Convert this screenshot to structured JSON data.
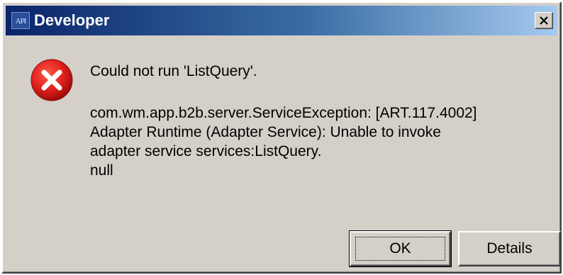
{
  "window": {
    "app_icon_text": "API",
    "title": "Developer"
  },
  "icons": {
    "error": "error-x-icon",
    "close": "close-icon"
  },
  "message": {
    "headline": "Could not run 'ListQuery'.",
    "lines": [
      "com.wm.app.b2b.server.ServiceException: [ART.117.4002]",
      "Adapter Runtime (Adapter Service): Unable to invoke",
      "adapter service services:ListQuery.",
      "null"
    ]
  },
  "buttons": {
    "ok_label": "OK",
    "details_label": "Details"
  },
  "colors": {
    "dialog_bg": "#d4d0c8",
    "titlebar_start": "#0a246a",
    "titlebar_end": "#a6caf0",
    "error_red": "#e0201c"
  }
}
